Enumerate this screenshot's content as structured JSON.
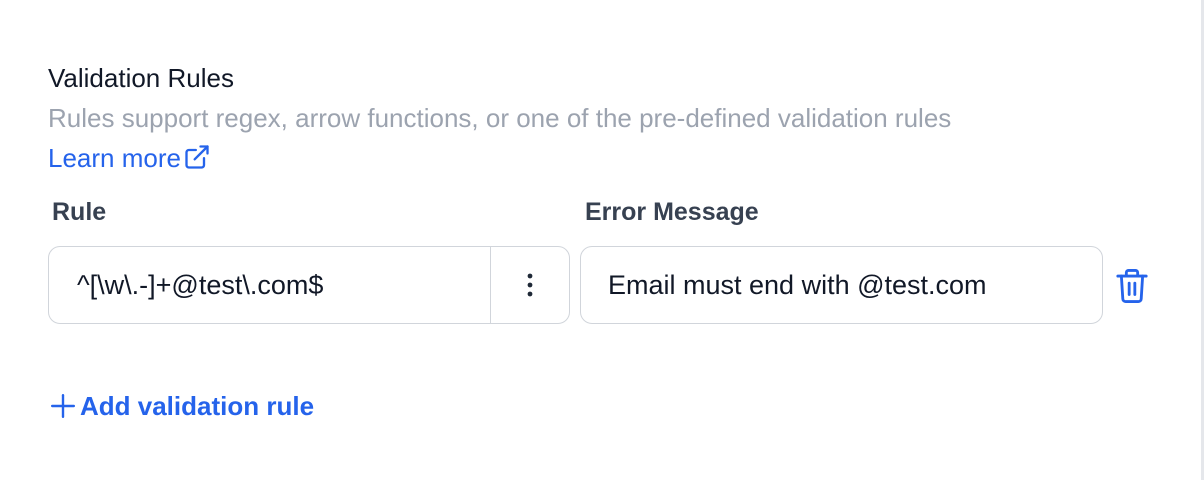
{
  "section": {
    "title": "Validation Rules",
    "description": "Rules support regex, arrow functions, or one of the pre-defined validation rules",
    "learn_more": "Learn more"
  },
  "columns": {
    "rule": "Rule",
    "error": "Error Message"
  },
  "rules": [
    {
      "rule": "^[\\w\\.-]+@test\\.com$",
      "error": "Email must end with @test.com"
    }
  ],
  "actions": {
    "add_rule": "Add validation rule"
  },
  "icons": {
    "learn_more": "external-link-icon",
    "rule_menu": "more-vertical-icon",
    "delete": "trash-icon",
    "add": "plus-icon"
  },
  "colors": {
    "accent": "#2563eb",
    "muted_text": "#9ca3af",
    "border": "#d1d5db",
    "text": "#111827"
  }
}
